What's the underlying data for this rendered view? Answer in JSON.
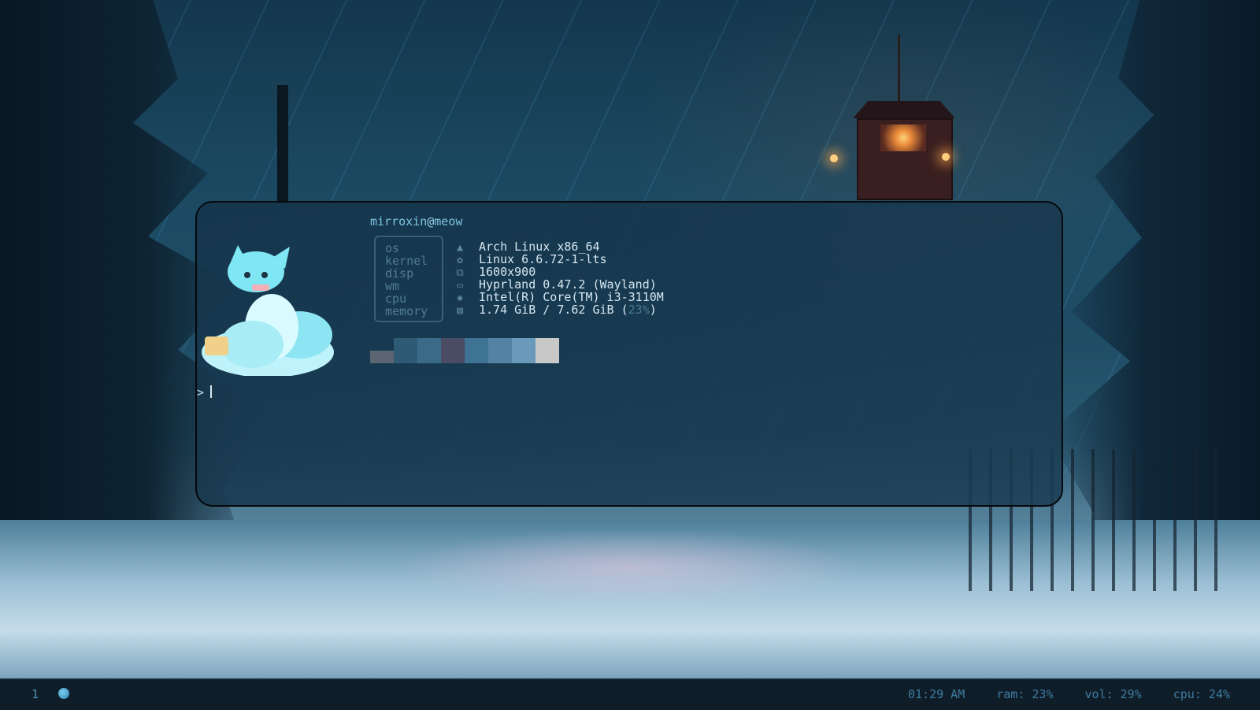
{
  "terminal": {
    "user": "mirroxin",
    "at": "@",
    "host": "meow",
    "labels": [
      "os",
      "kernel",
      "disp",
      "wm",
      "cpu",
      "memory"
    ],
    "icons": [
      "arch-icon",
      "kernel-gear-icon",
      "display-icon",
      "window-icon",
      "cpu-chip-icon",
      "memory-icon"
    ],
    "values": {
      "os": "Arch Linux x86_64",
      "kernel": "Linux 6.6.72-1-lts",
      "disp": "1600x900",
      "wm": "Hyprland 0.47.2 (Wayland)",
      "cpu": "Intel(R) Core(TM) i3-3110M",
      "memory_main": "1.74 GiB / 7.62 GiB (",
      "memory_pct": "23%",
      "memory_close": ")"
    },
    "palette": [
      "#5b6672",
      "#2e5a76",
      "#3b6a88",
      "#4a4c64",
      "#3f7394",
      "#5382a2",
      "#6a9ab9",
      "#c8c8c8"
    ],
    "prompt_symbol": ">"
  },
  "bar": {
    "workspace": "1",
    "time": "01:29 AM",
    "ram": "ram: 23%",
    "vol": "vol: 29%",
    "cpu": "cpu: 24%"
  }
}
